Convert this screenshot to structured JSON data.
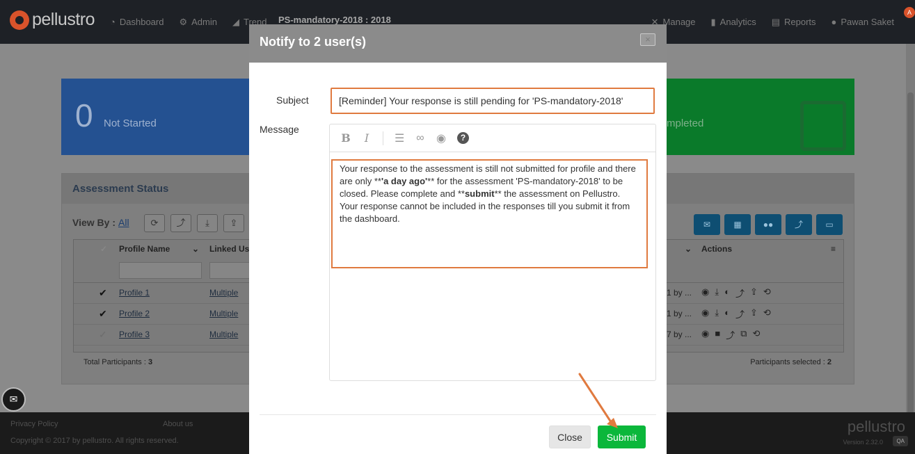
{
  "navbar": {
    "logo": "pellustro",
    "items_left": [
      {
        "label": "Dashboard",
        "icon": "dashboard-icon"
      },
      {
        "label": "Admin",
        "icon": "gear-icon"
      },
      {
        "label": "Trend",
        "icon": "trend-icon"
      }
    ],
    "assessment_title": "PS-mandatory-2018 : 2018",
    "items_right": [
      {
        "label": "Manage",
        "icon": "wrench-icon"
      },
      {
        "label": "Analytics",
        "icon": "bar-chart-icon"
      },
      {
        "label": "Reports",
        "icon": "report-icon"
      },
      {
        "label": "Pawan Saket",
        "icon": "user-icon"
      }
    ],
    "avatar_initial": "A"
  },
  "summary": {
    "not_started_count": "0",
    "not_started_label": "Not Started",
    "completed_label": "mpleted"
  },
  "assessment_status": {
    "title": "Assessment Status",
    "view_by_label": "View By :",
    "view_by_value": "All",
    "columns": [
      "Profile Name",
      "Linked Use",
      "Actions"
    ],
    "rows": [
      {
        "checked": true,
        "profile": "Profile 1",
        "linked": "Multiple",
        "trunc": "1 by ..."
      },
      {
        "checked": true,
        "profile": "Profile 2",
        "linked": "Multiple",
        "trunc": "1 by ..."
      },
      {
        "checked": false,
        "profile": "Profile 3",
        "linked": "Multiple",
        "trunc": "7 by ..."
      }
    ],
    "total_label": "Total Participants :",
    "total_value": "3",
    "selected_label": "Participants selected :",
    "selected_value": "2"
  },
  "footer": {
    "privacy": "Privacy Policy",
    "about": "About us",
    "copyright": "Copyright © 2017 by pellustro. All rights reserved.",
    "logo": "pellustro",
    "version": "Version 2.32.0",
    "env": "QA"
  },
  "modal": {
    "title": "Notify to 2 user(s)",
    "close_glyph": "×",
    "subject_label": "Subject",
    "subject_value": "[Reminder] Your response is still pending for 'PS-mandatory-2018'",
    "message_label": "Message",
    "message_parts": {
      "p1": "Your response to the assessment is still not submitted for profile and there are only **",
      "b1": "'a day ago'",
      "p2": "** for the assessment 'PS-mandatory-2018' to be closed. Please complete and **",
      "b2": "submit",
      "p3": "** the assessment on Pellustro. Your response cannot be included in the responses till you submit it from the dashboard."
    },
    "toolbar": {
      "bold": "B",
      "italic": "I",
      "help": "?"
    },
    "close_button": "Close",
    "submit_button": "Submit"
  },
  "colors": {
    "highlight": "#e07a3f",
    "submit": "#0bb73b",
    "navbar": "#1e2126"
  }
}
